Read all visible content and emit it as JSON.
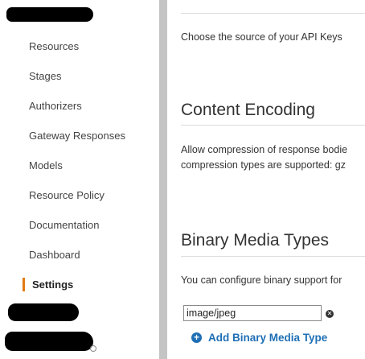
{
  "sidebar": {
    "items": [
      {
        "label": "Resources"
      },
      {
        "label": "Stages"
      },
      {
        "label": "Authorizers"
      },
      {
        "label": "Gateway Responses"
      },
      {
        "label": "Models"
      },
      {
        "label": "Resource Policy"
      },
      {
        "label": "Documentation"
      },
      {
        "label": "Dashboard"
      },
      {
        "label": "Settings",
        "active": true
      }
    ],
    "active_color": "#e07b14"
  },
  "api_key_source": {
    "description": "Choose the source of your API Keys"
  },
  "content_encoding": {
    "title": "Content Encoding",
    "description_line1": "Allow compression of response bodie",
    "description_line2": "compression types are supported: gz"
  },
  "binary_media_types": {
    "title": "Binary Media Types",
    "description": "You can configure binary support for",
    "types": [
      {
        "value": "image/jpeg"
      }
    ],
    "add_label": "Add Binary Media Type",
    "link_color": "#1f6fb5"
  }
}
